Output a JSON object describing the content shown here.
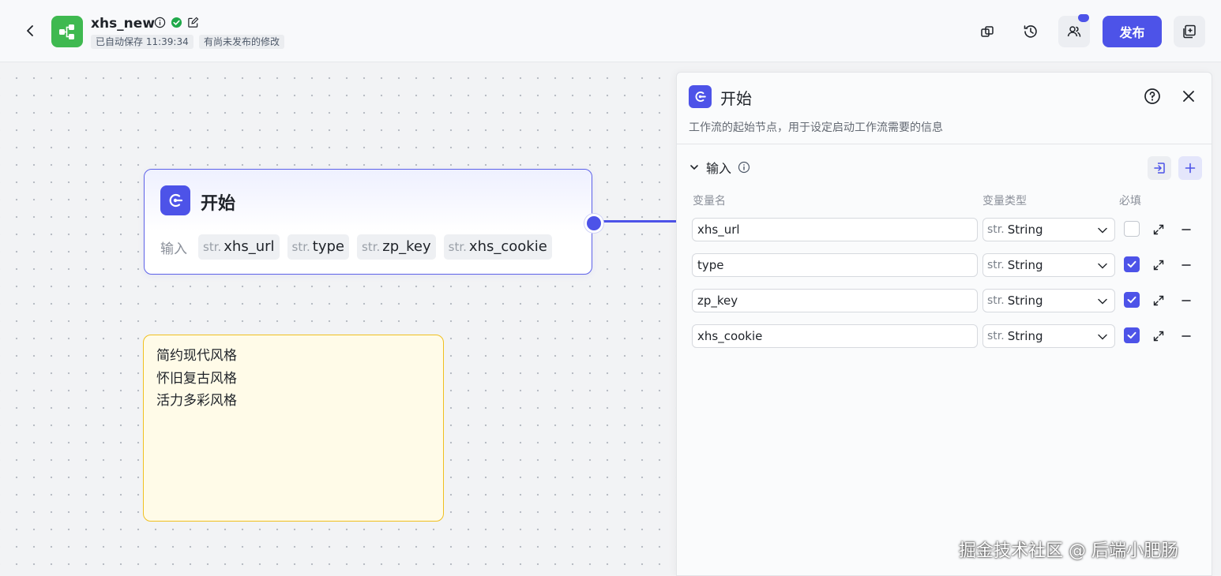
{
  "header": {
    "app_name": "xhs_new",
    "autosave_tag": "已自动保存 11:39:34",
    "unpublished_tag": "有尚未发布的修改",
    "publish_label": "发布"
  },
  "node": {
    "title": "开始",
    "inputs_label": "输入",
    "chips": [
      {
        "type": "str.",
        "name": "xhs_url"
      },
      {
        "type": "str.",
        "name": "type"
      },
      {
        "type": "str.",
        "name": "zp_key"
      },
      {
        "type": "str.",
        "name": "xhs_cookie"
      }
    ]
  },
  "note": {
    "lines": [
      "简约现代风格",
      "怀旧复古风格",
      "活力多彩风格"
    ]
  },
  "panel": {
    "title": "开始",
    "description": "工作流的起始节点，用于设定启动工作流需要的信息",
    "section_title": "输入",
    "col_name": "变量名",
    "col_type": "变量类型",
    "col_required": "必填",
    "variables": [
      {
        "name": "xhs_url",
        "type_prefix": "str.",
        "type": "String",
        "required": false
      },
      {
        "name": "type",
        "type_prefix": "str.",
        "type": "String",
        "required": true
      },
      {
        "name": "zp_key",
        "type_prefix": "str.",
        "type": "String",
        "required": true
      },
      {
        "name": "xhs_cookie",
        "type_prefix": "str.",
        "type": "String",
        "required": true
      }
    ]
  },
  "watermark": "掘金技术社区 @ 后端小肥肠",
  "colors": {
    "accent": "#4d53e8",
    "logo": "#3fb950",
    "note_border": "#f0c020"
  }
}
